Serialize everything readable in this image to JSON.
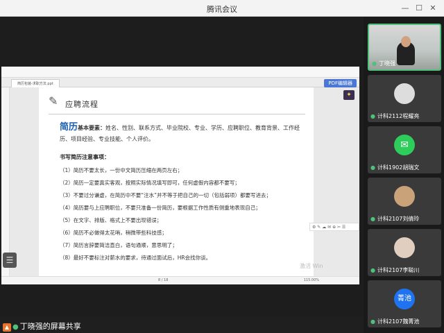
{
  "window": {
    "title": "腾讯会议"
  },
  "participants": [
    {
      "name": "丁晓强",
      "avatar": "camera",
      "color": "#4ec27a"
    },
    {
      "name": "计科2112程耀亮",
      "avatar": "anime",
      "color": "#ddd"
    },
    {
      "name": "计科1902胡瑞文",
      "avatar": "wechat-icon",
      "color": "#2ecc5b"
    },
    {
      "name": "计科2107刘倩玲",
      "avatar": "photo",
      "color": "#c9a27a"
    },
    {
      "name": "计科2107李聪川",
      "avatar": "anime2",
      "color": "#e0cfc0"
    },
    {
      "name": "计科2107魏菁池",
      "avatar": "菁池",
      "color": "#1f73f0"
    }
  ],
  "doc": {
    "tab": "简历包装-求职方法.ppt",
    "pdf_button": "PDF编辑器",
    "section_title": "应聘流程",
    "resume_big": "简历",
    "resume_label": "基本要素：",
    "resume_text": "姓名、性别、联系方式、毕业院校、专业、学历、应聘职位、教育背景、工作经历、项目经验、专业技能、个人评价。",
    "rules_heading": "书写简历注意事项：",
    "rules": [
      "（1）简历不要太长，一份中文简历压缩在两页左右；",
      "（2）简历一定要真实客观，按照实际情况填写即可，任何虚假内容都不要写；",
      "（3）不要过分谦虚，在简历中不要“注水”并不等于把自己的一切（包括弱项）都要写进去；",
      "（4）简历要与上应聘职位，不要只准备一份简历，要根据工作性质有侧重地表现自己；",
      "（5）在文字、排版、格式上不要出现错误；",
      "（6）简历不必做得太花哨，稍微带些科技感；",
      "（7）简历言辞要简洁直白，语句通顺，意思明了；",
      "（8）最好不要标注对薪水的要求，待通过面试后，HR会找你谈。"
    ],
    "page_indicator": "8 / 18",
    "zoom": "115.00%",
    "watermark": "激活 Win"
  },
  "share": {
    "label": "丁晓强的屏幕共享"
  }
}
